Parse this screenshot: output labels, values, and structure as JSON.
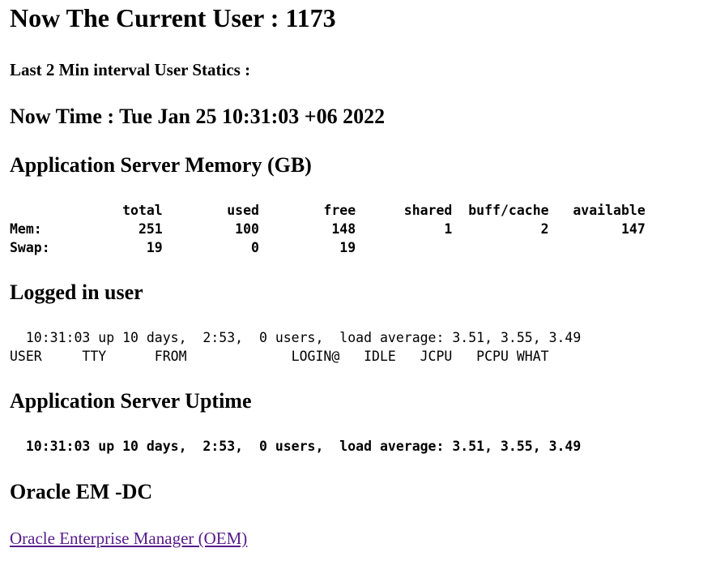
{
  "header": {
    "current_user": "Now The Current User : 1173",
    "interval_stats": "Last 2 Min interval User Statics :",
    "now_time": "Now Time : Tue Jan 25 10:31:03 +06 2022"
  },
  "memory": {
    "heading": "Application Server Memory (GB)",
    "table_text": "              total        used        free      shared  buff/cache   available\nMem:            251         100         148           1           2         147\nSwap:            19           0          19"
  },
  "logged_in": {
    "heading": "Logged in user",
    "text": "  10:31:03 up 10 days,  2:53,  0 users,  load average: 3.51, 3.55, 3.49\nUSER     TTY      FROM             LOGIN@   IDLE   JCPU   PCPU WHAT"
  },
  "uptime": {
    "heading": "Application Server Uptime",
    "text": "  10:31:03 up 10 days,  2:53,  0 users,  load average: 3.51, 3.55, 3.49"
  },
  "oracle": {
    "heading": "Oracle EM -DC",
    "link_label": "Oracle Enterprise Manager (OEM)"
  },
  "colors": {
    "link_visited": "#551a8b",
    "text": "#000000",
    "background": "#ffffff"
  }
}
